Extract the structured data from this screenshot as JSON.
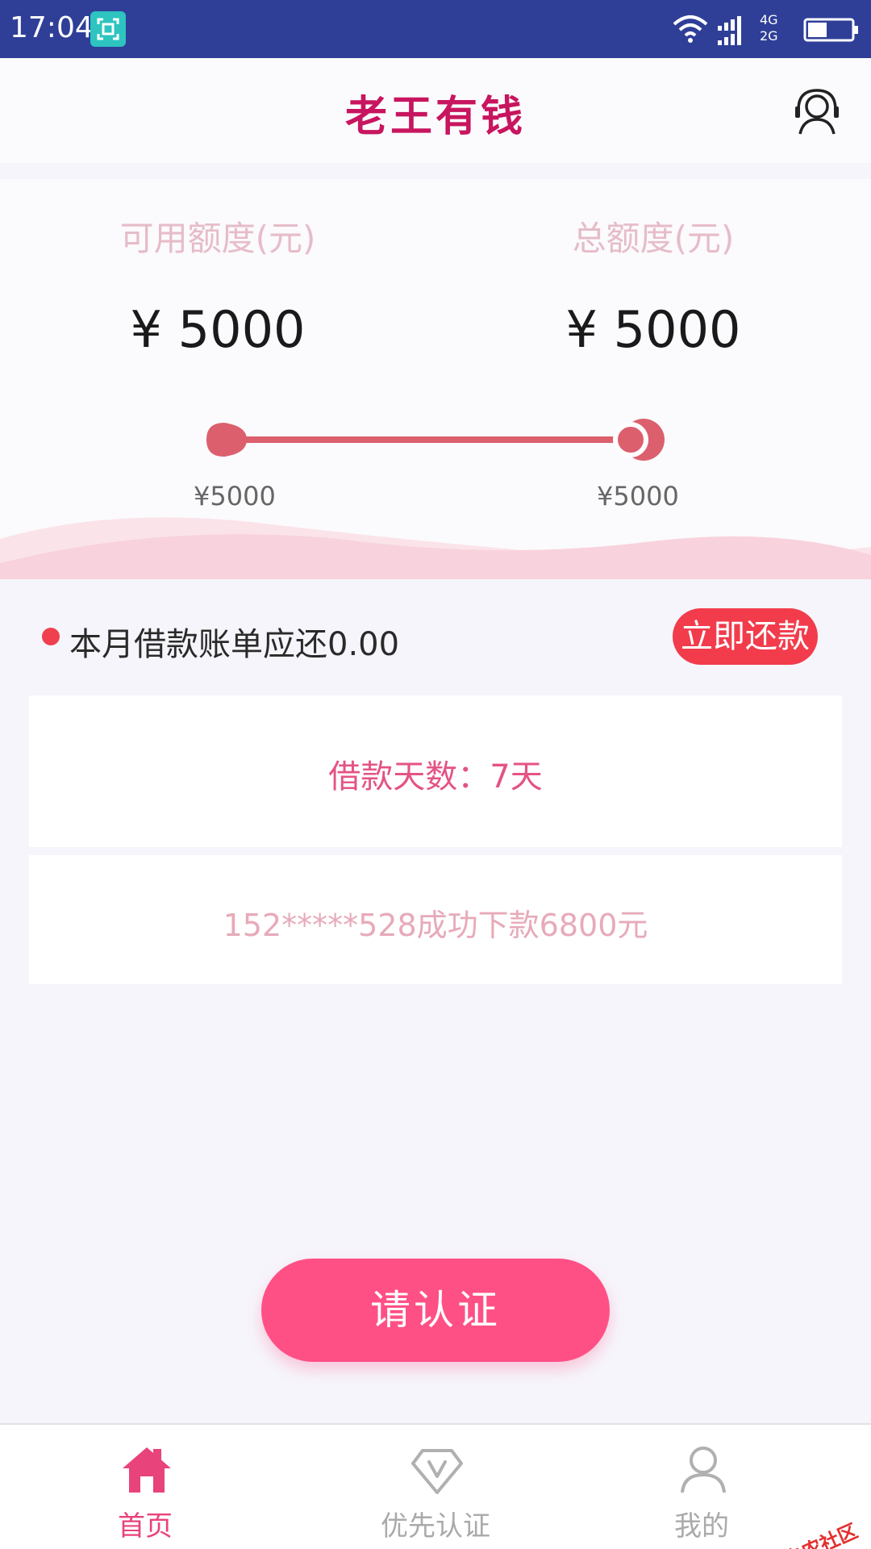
{
  "status_bar": {
    "time": "17:04",
    "network_top": "4G",
    "network_bottom": "2G",
    "battery_level": 0.45
  },
  "header": {
    "title": "老王有钱",
    "service_icon": "customer-service-headset-icon"
  },
  "credit": {
    "available_label": "可用额度(元)",
    "available_amount": "¥ 5000",
    "total_label": "总额度(元)",
    "total_amount": "¥ 5000",
    "slider_min_label": "¥5000",
    "slider_max_label": "¥5000",
    "slider_value_fraction": 1.0
  },
  "bill": {
    "text": "本月借款账单应还0.00",
    "repay_button": "立即还款"
  },
  "loan_days": "借款天数：7天",
  "notice": "152*****528成功下款6800元",
  "certify_button": "请认证",
  "bottom_nav": [
    {
      "label": "首页",
      "icon": "home-icon",
      "active": true
    },
    {
      "label": "优先认证",
      "icon": "vip-diamond-icon",
      "active": false
    },
    {
      "label": "我的",
      "icon": "user-icon",
      "active": false
    }
  ],
  "watermark": "卡农社区",
  "colors": {
    "status_bar": "#2f3f98",
    "brand": "#c8155f",
    "accent": "#ff5086",
    "repay": "#f23c4c",
    "slider": "#dc5f6e"
  }
}
